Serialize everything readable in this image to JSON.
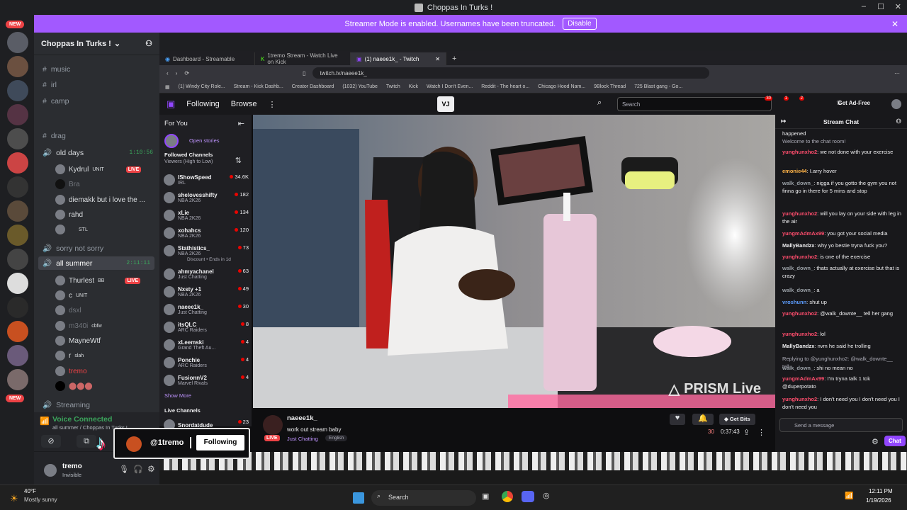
{
  "window": {
    "title": "Choppas In Turks !"
  },
  "banner": {
    "text": "Streamer Mode is enabled. Usernames have been truncated.",
    "button": "Disable"
  },
  "rail": {
    "new1": "NEW",
    "new2": "NEW"
  },
  "server": {
    "name": "Choppas In Turks !"
  },
  "channels": {
    "music": "music",
    "irl": "irl",
    "camp": "camp",
    "drag": "drag",
    "old_days": "old days",
    "old_days_time": "1:10:56",
    "sorry": "sorry not sorry",
    "all_summer": "all summer",
    "all_summer_time": "2:11:11",
    "streaming": "Streaming"
  },
  "old_days_users": [
    {
      "name": "Kydrul",
      "tag": "UNIT",
      "live": "LIVE"
    },
    {
      "name": "Bra",
      "tag": "",
      "live": ""
    },
    {
      "name": "diemakk but i love the ...",
      "tag": "",
      "live": ""
    },
    {
      "name": "rahd",
      "tag": "",
      "live": ""
    },
    {
      "name": "",
      "tag": "STL",
      "live": ""
    }
  ],
  "summer_users": [
    {
      "name": "Thurlest",
      "tag": "BB",
      "live": "LIVE"
    },
    {
      "name": "c",
      "tag": "UNIT",
      "live": ""
    },
    {
      "name": "dsxl",
      "tag": "",
      "live": ""
    },
    {
      "name": "m340i",
      "tag": "cbfw",
      "live": ""
    },
    {
      "name": "MayneWtf",
      "tag": "",
      "live": ""
    },
    {
      "name": "r",
      "tag": "slah",
      "live": ""
    },
    {
      "name": "tremo",
      "tag": "",
      "live": ""
    }
  ],
  "voice": {
    "status": "Voice Connected",
    "location": "all summer / Choppas In Turks !"
  },
  "me": {
    "name": "tremo",
    "status": "Invisible"
  },
  "mini": {
    "handle": "@1tremo",
    "button": "Following"
  },
  "browser": {
    "tabs": [
      "Dashboard - Streamable",
      "1tremo Stream - Watch Live on Kick",
      "(1) naeee1k_ - Twitch"
    ],
    "url": "twitch.tv/naeee1k_",
    "bookmarks": [
      "(1) Windy City Role...",
      "Stream - Kick Dashb...",
      "Creator Dashboard",
      "(1032) YouTube",
      "Twitch",
      "Kick",
      "Watch I Don't Even...",
      "Reddit - The heart o...",
      "Chicago Hood Nam...",
      "9Block Thread",
      "725 Blast gang - Go..."
    ]
  },
  "twitch": {
    "following": "Following",
    "browse": "Browse",
    "search_placeholder": "Search",
    "get_ad_free": "Get Ad-Free",
    "badges": [
      "30",
      "1",
      "2"
    ],
    "for_you": "For You",
    "open_stories": "Open stories",
    "followed_channels": "Followed Channels",
    "sort": "Viewers (High to Low)",
    "show_more": "Show More",
    "live_channels": "Live Channels",
    "channels": [
      {
        "name": "IShowSpeed",
        "game": "IRL",
        "viewers": "34.6K"
      },
      {
        "name": "shelovesshifty",
        "game": "NBA 2K26",
        "viewers": "182"
      },
      {
        "name": "xLie",
        "game": "NBA 2K26",
        "viewers": "134"
      },
      {
        "name": "xohahcs",
        "game": "NBA 2K26",
        "viewers": "120"
      },
      {
        "name": "Stathistics_",
        "game": "NBA 2K26",
        "viewers": "73"
      },
      {
        "name": "ahmyachanel",
        "game": "Just Chatting",
        "viewers": "63"
      },
      {
        "name": "Nxsty +1",
        "game": "NBA 2K26",
        "viewers": "49"
      },
      {
        "name": "naeee1k_",
        "game": "Just Chatting",
        "viewers": "30"
      },
      {
        "name": "itsQLC",
        "game": "ARC Raiders",
        "viewers": "8"
      },
      {
        "name": "xLeemski",
        "game": "Grand Theft Au...",
        "viewers": "4"
      },
      {
        "name": "Ponchie",
        "game": "ARC Raiders",
        "viewers": "4"
      },
      {
        "name": "FusionnV2",
        "game": "Marvel Rivals",
        "viewers": "4"
      },
      {
        "name": "Snordatdude",
        "game": "",
        "viewers": "23"
      }
    ],
    "discount": "Discount • Ends in 1d",
    "watermark": "PRISM Live",
    "stream": {
      "channel": "naeee1k_",
      "title": "work out stream baby",
      "category": "Just Chatting",
      "tag": "English",
      "live": "LIVE",
      "viewers": "30",
      "uptime": "0:37:43",
      "bits": "Get Bits"
    }
  },
  "chat": {
    "header": "Stream Chat",
    "placeholder": "Send a message",
    "button": "Chat",
    "messages": [
      {
        "user": "",
        "color": "#efeff1",
        "text": "happened"
      },
      {
        "user": "",
        "color": "#adadb8",
        "text": "Welcome to the chat room!"
      },
      {
        "user": "yunghunxho2",
        "color": "#ff4d6d",
        "text": "we not done with your exercise"
      },
      {
        "user": "emonie44",
        "color": "#ffb347",
        "text": "I.arry hover"
      },
      {
        "user": "walk_down_",
        "color": "#9aa0a6",
        "text": "nigga if you gotto the gym you not finna go in there for 5 mins and stop"
      },
      {
        "user": "yunghunxho2",
        "color": "#ff4d6d",
        "text": "will you lay on your side with leg in the air"
      },
      {
        "user": "yungmAdmAx99",
        "color": "#ff4d6d",
        "text": "you got your social media"
      },
      {
        "user": "MallyBandzx",
        "color": "#efeff1",
        "text": "why yo bestie tryna fuck you?"
      },
      {
        "user": "yunghunxho2",
        "color": "#ff4d6d",
        "text": "is one of the exercise"
      },
      {
        "user": "walk_down_",
        "color": "#9aa0a6",
        "text": "thats actually at exercise but that is crazy"
      },
      {
        "user": "walk_down_",
        "color": "#9aa0a6",
        "text": "a"
      },
      {
        "user": "vroshunn",
        "color": "#5c9dff",
        "text": "shut up"
      },
      {
        "user": "yunghunxho2",
        "color": "#ff4d6d",
        "text": "@walk_downte__ tell her gang"
      },
      {
        "user": "yunghunxho2",
        "color": "#ff4d6d",
        "text": "lol"
      },
      {
        "user": "MallyBandzx",
        "color": "#efeff1",
        "text": "nvm he said he trolling"
      },
      {
        "user": "",
        "color": "#adadb8",
        "text": "Replying to @yunghunxho2: @walk_downte__ tell..."
      },
      {
        "user": "walk_down_",
        "color": "#9aa0a6",
        "text": "shi no mean no"
      },
      {
        "user": "yungmAdmAx99",
        "color": "#ff4d6d",
        "text": "I'm tryna talk 1 tok @duperpotato"
      },
      {
        "user": "yunghunxho2",
        "color": "#ff4d6d",
        "text": "I don't need you I don't need you I don't need you"
      }
    ]
  },
  "taskbar": {
    "temp": "40°F",
    "weather": "Mostly sunny",
    "search": "Search",
    "time": "12:11 PM",
    "date": "1/19/2026"
  }
}
